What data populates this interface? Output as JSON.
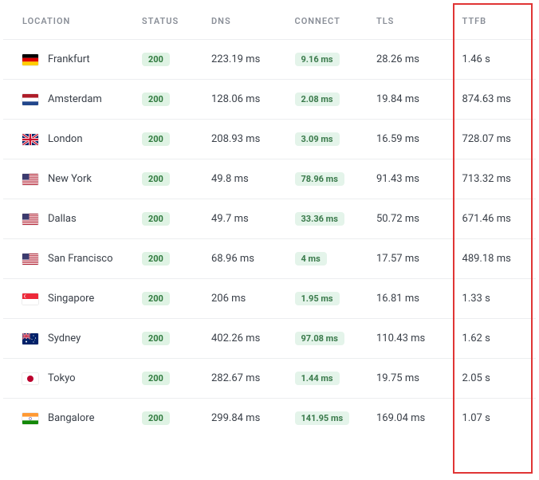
{
  "headers": {
    "location": "LOCATION",
    "status": "STATUS",
    "dns": "DNS",
    "connect": "CONNECT",
    "tls": "TLS",
    "ttfb": "TTFB"
  },
  "rows": [
    {
      "flag": "de",
      "location": "Frankfurt",
      "status": "200",
      "dns": "223.19 ms",
      "connect": "9.16 ms",
      "tls": "28.26 ms",
      "ttfb": "1.46 s"
    },
    {
      "flag": "nl",
      "location": "Amsterdam",
      "status": "200",
      "dns": "128.06 ms",
      "connect": "2.08 ms",
      "tls": "19.84 ms",
      "ttfb": "874.63 ms"
    },
    {
      "flag": "gb",
      "location": "London",
      "status": "200",
      "dns": "208.93 ms",
      "connect": "3.09 ms",
      "tls": "16.59 ms",
      "ttfb": "728.07 ms"
    },
    {
      "flag": "us",
      "location": "New York",
      "status": "200",
      "dns": "49.8 ms",
      "connect": "78.96 ms",
      "tls": "91.43 ms",
      "ttfb": "713.32 ms"
    },
    {
      "flag": "us",
      "location": "Dallas",
      "status": "200",
      "dns": "49.7 ms",
      "connect": "33.36 ms",
      "tls": "50.72 ms",
      "ttfb": "671.46 ms"
    },
    {
      "flag": "us",
      "location": "San Francisco",
      "status": "200",
      "dns": "68.96 ms",
      "connect": "4 ms",
      "tls": "17.57 ms",
      "ttfb": "489.18 ms"
    },
    {
      "flag": "sg",
      "location": "Singapore",
      "status": "200",
      "dns": "206 ms",
      "connect": "1.95 ms",
      "tls": "16.81 ms",
      "ttfb": "1.33 s"
    },
    {
      "flag": "au",
      "location": "Sydney",
      "status": "200",
      "dns": "402.26 ms",
      "connect": "97.08 ms",
      "tls": "110.43 ms",
      "ttfb": "1.62 s"
    },
    {
      "flag": "jp",
      "location": "Tokyo",
      "status": "200",
      "dns": "282.67 ms",
      "connect": "1.44 ms",
      "tls": "19.75 ms",
      "ttfb": "2.05 s"
    },
    {
      "flag": "in",
      "location": "Bangalore",
      "status": "200",
      "dns": "299.84 ms",
      "connect": "141.95 ms",
      "tls": "169.04 ms",
      "ttfb": "1.07 s"
    }
  ],
  "highlight_column": "ttfb"
}
